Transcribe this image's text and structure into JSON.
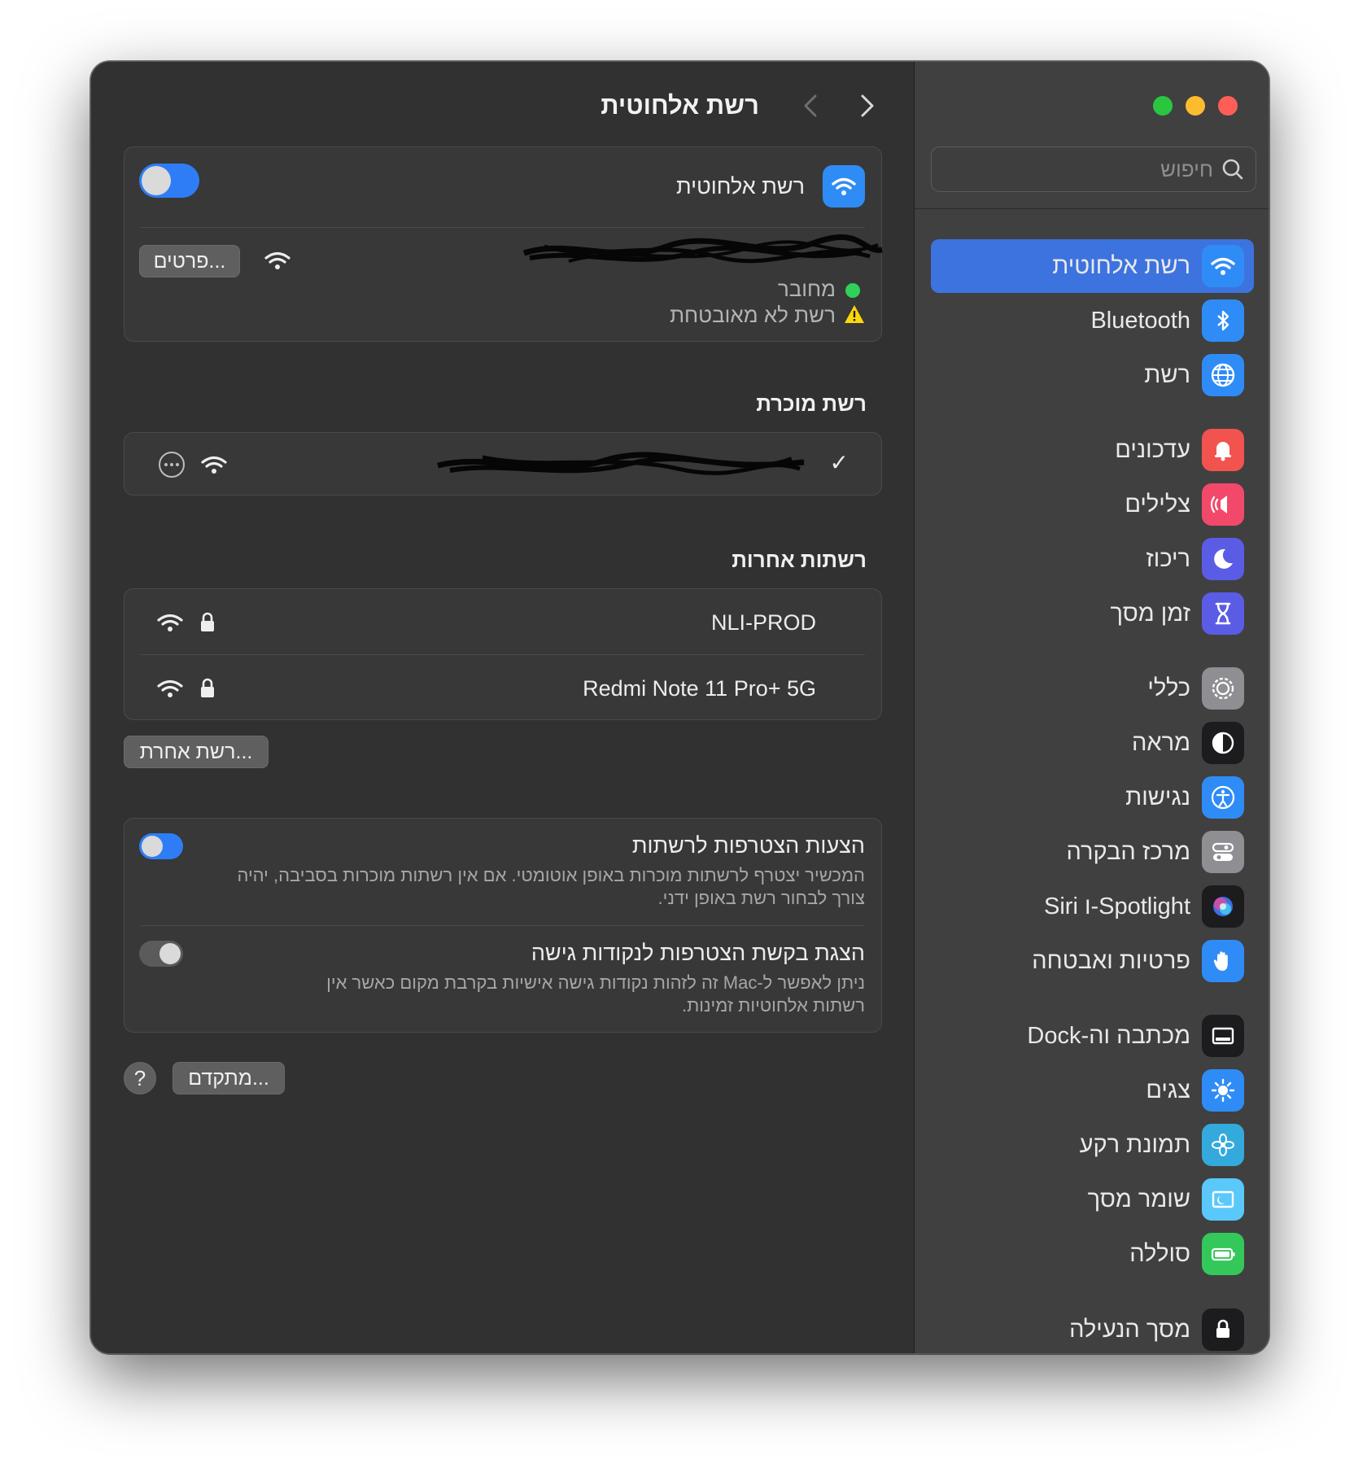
{
  "window": {
    "title": "רשת אלחוטית"
  },
  "sidebar": {
    "search_placeholder": "חיפוש",
    "items": [
      {
        "label": "רשת אלחוטית",
        "icon": "wifi-icon",
        "color": "#2f8cf6"
      },
      {
        "label": "Bluetooth",
        "icon": "bluetooth-icon",
        "color": "#2f8cf6"
      },
      {
        "label": "רשת",
        "icon": "globe-icon",
        "color": "#2f8cf6"
      },
      {
        "label": "עדכונים",
        "icon": "bell-icon",
        "color": "#f2534e"
      },
      {
        "label": "צלילים",
        "icon": "speaker-icon",
        "color": "#f2496b"
      },
      {
        "label": "ריכוז",
        "icon": "moon-icon",
        "color": "#5b5ce6"
      },
      {
        "label": "זמן מסך",
        "icon": "hourglass-icon",
        "color": "#5b5ce6"
      },
      {
        "label": "כללי",
        "icon": "gear-icon",
        "color": "#8e8e93"
      },
      {
        "label": "מראה",
        "icon": "appearance-icon",
        "color": "#1c1c1e"
      },
      {
        "label": "נגישות",
        "icon": "accessibility-icon",
        "color": "#2f8cf6"
      },
      {
        "label": "מרכז הבקרה",
        "icon": "control-center-icon",
        "color": "#8e8e93"
      },
      {
        "label": "Spotlight-ו Siri",
        "icon": "siri-icon",
        "color": "#1c1c1e"
      },
      {
        "label": "פרטיות ואבטחה",
        "icon": "hand-icon",
        "color": "#2f8cf6"
      },
      {
        "label": "מכתבה וה-Dock",
        "icon": "dock-icon",
        "color": "#1c1c1e"
      },
      {
        "label": "צגים",
        "icon": "sun-icon",
        "color": "#2f8cf6"
      },
      {
        "label": "תמונת רקע",
        "icon": "flower-icon",
        "color": "#34aadc"
      },
      {
        "label": "שומר מסך",
        "icon": "screensaver-icon",
        "color": "#5ac8fa"
      },
      {
        "label": "סוללה",
        "icon": "battery-icon",
        "color": "#34c759"
      },
      {
        "label": "מסך הנעילה",
        "icon": "lock-icon",
        "color": "#1c1c1e"
      }
    ]
  },
  "main": {
    "wifi_card": {
      "label": "רשת אלחוטית",
      "toggle_on": true,
      "current_network": {
        "status": "מחובר",
        "status_color": "#30d158",
        "warning": "רשת לא מאובטחת",
        "warning_color": "#ffd60a",
        "details_button": "פרטים..."
      }
    },
    "known_section": {
      "title": "רשת מוכרת",
      "check_mark": "✓",
      "more_icon": "ellipsis-circle-icon"
    },
    "other_section": {
      "title": "רשתות אחרות",
      "networks": [
        {
          "name": "NLI-PROD",
          "locked": true
        },
        {
          "name": "Redmi Note 11 Pro+ 5G",
          "locked": true
        }
      ],
      "other_button": "רשת אחרת..."
    },
    "settings": [
      {
        "title": "הצעות הצטרפות לרשתות",
        "description_line1": "המכשיר יצטרף לרשתות מוכרות באופן אוטומטי. אם אין רשתות מוכרות בסביבה, יהיה",
        "description_line2": "צורך לבחור רשת באופן ידני.",
        "toggle_on": true
      },
      {
        "title": "הצגת בקשת הצטרפות לנקודות גישה",
        "description_line1": "ניתן לאפשר ל-Mac זה לזהות נקודות גישה אישיות בקרבת מקום כאשר אין",
        "description_line2": "רשתות אלחוטיות זמינות.",
        "toggle_on": false
      }
    ],
    "advanced_button": "מתקדם...",
    "help_button": "?"
  }
}
